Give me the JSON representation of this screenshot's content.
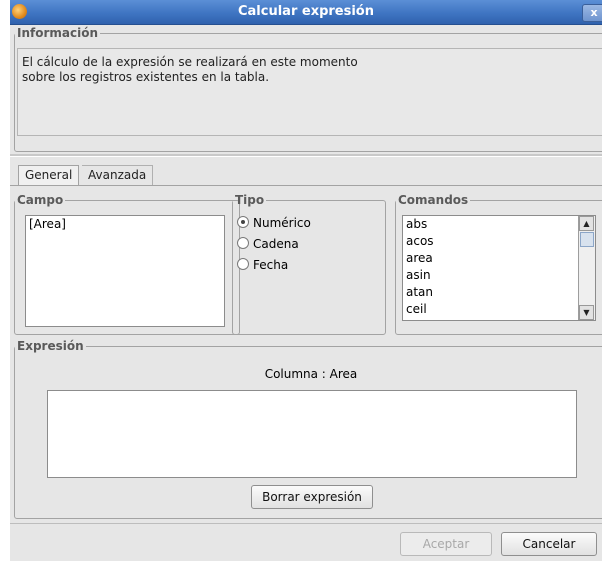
{
  "window": {
    "title": "Calcular expresión",
    "close_label": "x"
  },
  "informacion": {
    "legend": "Información",
    "line1": "El cálculo de la expresión se realizará en este momento",
    "line2": "sobre los registros existentes en la tabla."
  },
  "tabs": [
    {
      "label": "General",
      "selected": true
    },
    {
      "label": "Avanzada",
      "selected": false
    }
  ],
  "campo": {
    "legend": "Campo",
    "items": [
      "[Area]"
    ]
  },
  "tipo": {
    "legend": "Tipo",
    "options": [
      {
        "label": "Numérico",
        "checked": true
      },
      {
        "label": "Cadena",
        "checked": false
      },
      {
        "label": "Fecha",
        "checked": false
      }
    ]
  },
  "comandos": {
    "legend": "Comandos",
    "items": [
      "abs",
      "acos",
      "area",
      "asin",
      "atan",
      "ceil"
    ]
  },
  "expresion": {
    "legend": "Expresión",
    "column_label": "Columna : Area",
    "value": "",
    "clear_label": "Borrar expresión"
  },
  "footer": {
    "accept_label": "Aceptar",
    "accept_enabled": false,
    "cancel_label": "Cancelar"
  }
}
